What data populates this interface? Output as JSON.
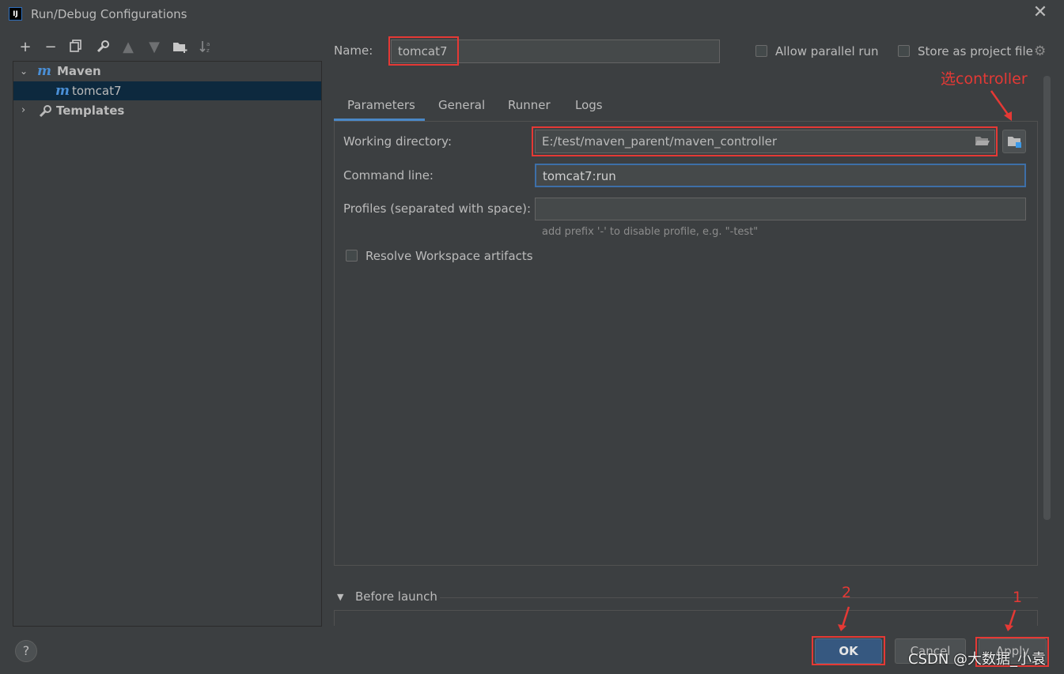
{
  "window": {
    "title": "Run/Debug Configurations",
    "app_icon_text": "IJ"
  },
  "toolbar": {
    "icons": [
      "add-icon",
      "remove-icon",
      "copy-icon",
      "wrench-icon",
      "move-up-icon",
      "move-down-icon",
      "new-folder-icon",
      "sort-icon"
    ]
  },
  "tree": {
    "maven_label": "Maven",
    "maven_icon_text": "m",
    "child_label": "tomcat7",
    "templates_label": "Templates"
  },
  "name_row": {
    "label": "Name:",
    "value": "tomcat7",
    "allow_parallel_label": "Allow parallel run",
    "store_project_label": "Store as project file"
  },
  "tabs": [
    "Parameters",
    "General",
    "Runner",
    "Logs"
  ],
  "params": {
    "working_dir_label": "Working directory:",
    "working_dir_value": "E:/test/maven_parent/maven_controller",
    "command_line_label": "Command line:",
    "command_line_value": "tomcat7:run",
    "profiles_label": "Profiles (separated with space):",
    "profiles_value": "",
    "profiles_hint": "add prefix '-' to disable profile, e.g. \"-test\"",
    "resolve_label": "Resolve Workspace artifacts"
  },
  "before_launch": {
    "label": "Before launch"
  },
  "buttons": {
    "ok": "OK",
    "cancel": "Cancel",
    "apply": "Apply",
    "help": "?"
  },
  "annotations": {
    "controller": "选controller",
    "step2": "2",
    "step1": "1",
    "watermark": "CSDN @大数据_小袁"
  },
  "colors": {
    "accent": "#4a88c7",
    "annotation": "#e53935",
    "background": "#3c3f41",
    "selection": "#0d293e"
  }
}
